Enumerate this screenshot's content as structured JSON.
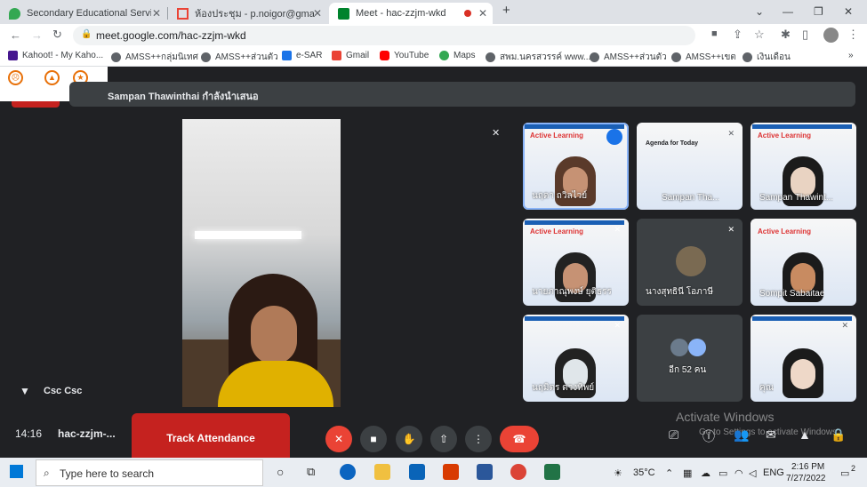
{
  "tabs": [
    {
      "title": "Secondary Educational Service A",
      "icon": "maps-pin-icon"
    },
    {
      "title": "ห้องประชุม - p.noigor@gmail.com",
      "icon": "gmail-icon"
    },
    {
      "title": "Meet - hac-zzjm-wkd",
      "icon": "meet-icon",
      "recording": true
    }
  ],
  "url": "meet.google.com/hac-zzjm-wkd",
  "bookmarks": [
    "Kahoot! - My Kaho...",
    "AMSS++กลุ่มนิเทศ",
    "AMSS++ส่วนตัว",
    "e-SAR",
    "Gmail",
    "YouTube",
    "Maps",
    "สพม.นครสวรรค์ www....",
    "AMSS++ส่วนตัว",
    "AMSS++เขต",
    "เงินเดือน"
  ],
  "presenting": "Sampan Thawinthai กำลังนำเสนอ",
  "pinned_name": "Csc Csc",
  "tiles": [
    {
      "name": "นฤดา ถวิลไวย์",
      "type": "slide",
      "active": true
    },
    {
      "name": "Sampan Tha...",
      "type": "slide-agenda",
      "agenda": "Agenda for Today"
    },
    {
      "name": "Sampan Thawint...",
      "type": "slide"
    },
    {
      "name": "นายภาณุพงษ์ ยุติธรร",
      "type": "slide"
    },
    {
      "name": "นางสุทธินี โอภาษี",
      "type": "avatar"
    },
    {
      "name": "Sompit Sabaitae",
      "type": "slide"
    },
    {
      "name": "นฤมิตร ดวงทิพย์",
      "type": "slide"
    },
    {
      "name": "อีก 52 คน",
      "type": "more"
    },
    {
      "name": "คุณ",
      "type": "slide"
    }
  ],
  "slide_heading": "Active Learning",
  "bottom": {
    "time": "14:16",
    "code": "hac-zzjm-...",
    "track_label": "Track Attendance",
    "activate_title": "Activate Windows",
    "activate_sub": "Go to Settings to activate Windows."
  },
  "taskbar": {
    "search_placeholder": "Type here to search",
    "weather": "35°C",
    "lang": "ENG",
    "time": "2:16 PM",
    "date": "7/27/2022",
    "notif_count": "2"
  },
  "colors": {
    "accent": "#8ab4f8",
    "end_call": "#ea4335",
    "track": "#c5221f"
  }
}
